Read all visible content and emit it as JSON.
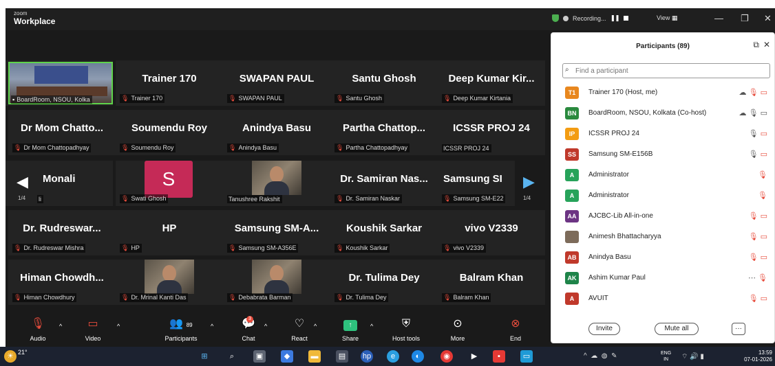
{
  "window": {
    "brand_small": "zoom",
    "brand_title": "Workplace",
    "recording_label": "Recording...",
    "view_label": "View",
    "minimize": "—",
    "restore": "❐",
    "close": "✕"
  },
  "gallery": {
    "page_indicator": "1/4",
    "tiles": [
      {
        "name": "",
        "label": "BoardRoom, NSOU, Kolka"
      },
      {
        "name": "Trainer 170",
        "label": "Trainer 170"
      },
      {
        "name": "SWAPAN PAUL",
        "label": "SWAPAN PAUL"
      },
      {
        "name": "Santu Ghosh",
        "label": "Santu Ghosh"
      },
      {
        "name": "Deep Kumar Kir...",
        "label": "Deep Kumar Kirtania"
      },
      {
        "name": "Dr Mom Chatto...",
        "label": "Dr Mom Chattopadhyay"
      },
      {
        "name": "Soumendu Roy",
        "label": "Soumendu Roy"
      },
      {
        "name": "Anindya Basu",
        "label": "Anindya Basu"
      },
      {
        "name": "Partha Chattop...",
        "label": "Partha Chattopadhyay"
      },
      {
        "name": "ICSSR PROJ 24",
        "label": "ICSSR PROJ 24"
      },
      {
        "name": "Monali",
        "label": "li"
      },
      {
        "name": "S",
        "label": "Swati Ghosh"
      },
      {
        "name": "",
        "label": "Tanushree Rakshit"
      },
      {
        "name": "Dr. Samiran Nas...",
        "label": "Dr. Samiran Naskar"
      },
      {
        "name": "Samsung SI",
        "label": "Samsung SM-E22"
      },
      {
        "name": "Dr. Rudreswar...",
        "label": "Dr. Rudreswar Mishra"
      },
      {
        "name": "HP",
        "label": "HP"
      },
      {
        "name": "Samsung SM-A...",
        "label": "Samsung SM-A356E"
      },
      {
        "name": "Koushik Sarkar",
        "label": "Koushik Sarkar"
      },
      {
        "name": "vivo V2339",
        "label": "vivo V2339"
      },
      {
        "name": "Himan Chowdh...",
        "label": "Himan Chowdhury"
      },
      {
        "name": "",
        "label": "Dr. Mrinal Kanti Das"
      },
      {
        "name": "",
        "label": "Debabrata Barman"
      },
      {
        "name": "Dr. Tulima Dey",
        "label": "Dr. Tulima Dey"
      },
      {
        "name": "Balram Khan",
        "label": "Balram Khan"
      }
    ]
  },
  "toolbar": {
    "audio": "Audio",
    "video": "Video",
    "participants": "Participants",
    "participants_count": "89",
    "chat": "Chat",
    "chat_badge": "3",
    "react": "React",
    "share": "Share",
    "host_tools": "Host tools",
    "more": "More",
    "end": "End"
  },
  "participants_panel": {
    "title": "Participants (89)",
    "search_placeholder": "Find a participant",
    "invite": "Invite",
    "mute_all": "Mute all",
    "more_dots": "···",
    "list": [
      {
        "initials": "T1",
        "name": "Trainer 170 (Host, me)",
        "color": "#e8871e"
      },
      {
        "initials": "BN",
        "name": "BoardRoom, NSOU, Kolkata (Co-host)",
        "color": "#2a8a3e"
      },
      {
        "initials": "IP",
        "name": "ICSSR PROJ 24",
        "color": "#f39c12"
      },
      {
        "initials": "SS",
        "name": "Samsung SM-E156B",
        "color": "#c0392b"
      },
      {
        "initials": "A",
        "name": "Administrator",
        "color": "#27a35a"
      },
      {
        "initials": "A",
        "name": "Administrator",
        "color": "#27a35a"
      },
      {
        "initials": "AA",
        "name": "AJCBC-Lib All-in-one",
        "color": "#6c3483"
      },
      {
        "initials": "",
        "name": "Animesh Bhattacharyya",
        "color": "#7d6b5a"
      },
      {
        "initials": "AB",
        "name": "Anindya Basu",
        "color": "#c0392b"
      },
      {
        "initials": "AK",
        "name": "Ashim Kumar Paul",
        "color": "#1e8449"
      },
      {
        "initials": "A",
        "name": "AVUIT",
        "color": "#c0392b"
      }
    ]
  },
  "taskbar": {
    "weather": "21°",
    "lang_top": "ENG",
    "lang_bottom": "IN",
    "time": "13:59",
    "date": "07-01-2026"
  }
}
